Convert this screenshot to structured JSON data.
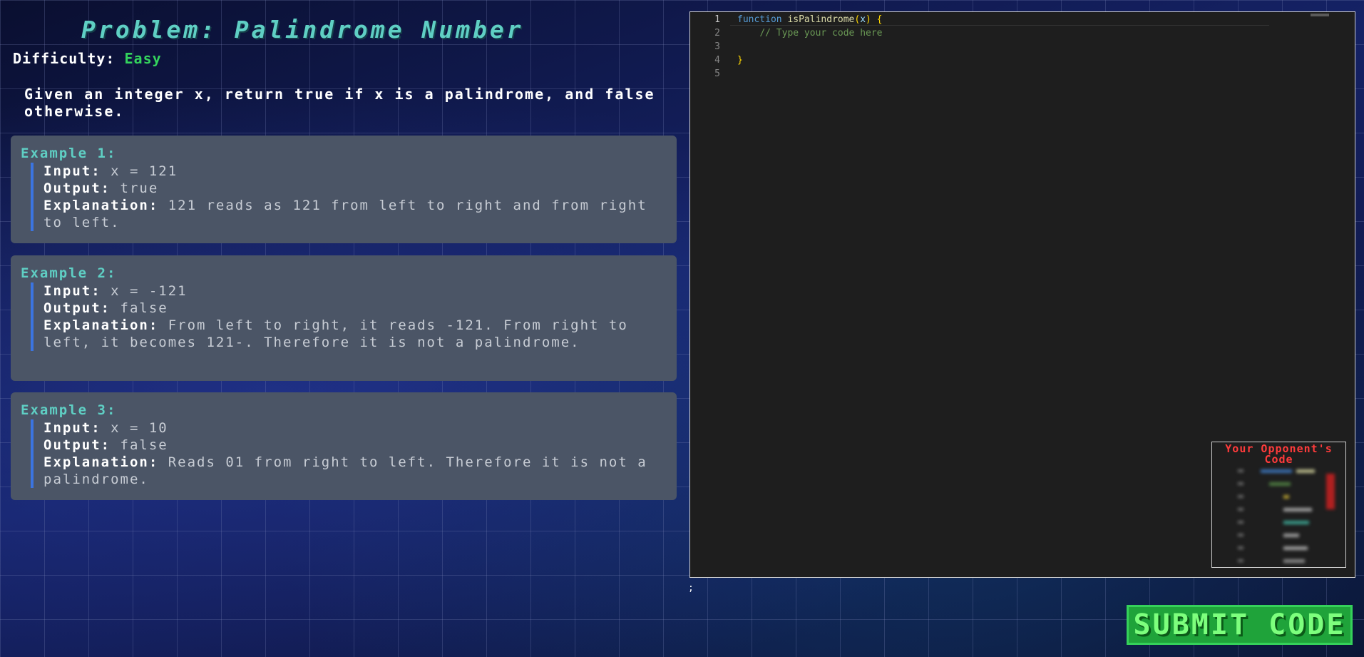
{
  "problem": {
    "title": "Problem: Palindrome Number",
    "difficulty_label": "Difficulty:",
    "difficulty": "Easy",
    "description": "Given an integer x, return true if x is a palindrome, and false otherwise."
  },
  "labels": {
    "input": "Input:",
    "output": "Output:",
    "explanation": "Explanation:"
  },
  "examples": [
    {
      "title": "Example 1:",
      "input": "x = 121",
      "output": "true",
      "explanation": "121 reads as 121 from left to right and from right to left."
    },
    {
      "title": "Example 2:",
      "input": "x = -121",
      "output": "false",
      "explanation": "From left to right, it reads -121. From right to left, it becomes 121-. Therefore it is not a palindrome."
    },
    {
      "title": "Example 3:",
      "input": "x = 10",
      "output": "false",
      "explanation": "Reads 01 from right to left. Therefore it is not a palindrome."
    }
  ],
  "editor": {
    "line_numbers": [
      "1",
      "2",
      "3",
      "4",
      "5"
    ],
    "tokens": {
      "keyword": "function",
      "fn_name": "isPalindrome",
      "open_paren": "(",
      "param": "x",
      "close_paren_brace": ") {",
      "comment": "// Type your code here",
      "close_brace": "}"
    },
    "trailing_text": ";"
  },
  "opponent": {
    "title": "Your Opponent's Code"
  },
  "submit": {
    "label": "SUBMIT CODE"
  }
}
